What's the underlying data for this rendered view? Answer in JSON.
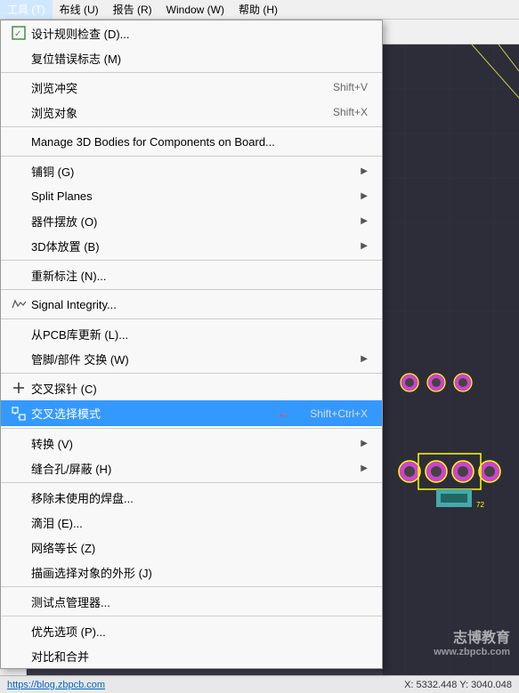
{
  "menubar": {
    "items": [
      {
        "label": "工具 (T)",
        "active": true
      },
      {
        "label": "布线 (U)",
        "active": false
      },
      {
        "label": "报告 (R)",
        "active": false
      },
      {
        "label": "Window (W)",
        "active": false
      },
      {
        "label": "帮助 (H)",
        "active": false
      }
    ]
  },
  "dropdown": {
    "items": [
      {
        "id": "design-rule-check",
        "icon": "✓",
        "text": "设计规则检查 (D)...",
        "shortcut": "",
        "hasArrow": false,
        "separator_after": false,
        "highlighted": false
      },
      {
        "id": "reset-error-marks",
        "icon": "",
        "text": "复位错误标志 (M)",
        "shortcut": "",
        "hasArrow": false,
        "separator_after": true,
        "highlighted": false
      },
      {
        "id": "browse-conflicts",
        "icon": "",
        "text": "浏览冲突",
        "shortcut": "Shift+V",
        "hasArrow": false,
        "separator_after": false,
        "highlighted": false
      },
      {
        "id": "browse-objects",
        "icon": "",
        "text": "浏览对象",
        "shortcut": "Shift+X",
        "hasArrow": false,
        "separator_after": true,
        "highlighted": false
      },
      {
        "id": "manage-3d-bodies",
        "icon": "",
        "text": "Manage 3D Bodies for Components on Board...",
        "shortcut": "",
        "hasArrow": false,
        "separator_after": true,
        "highlighted": false
      },
      {
        "id": "copper-pour",
        "icon": "",
        "text": "铺铜 (G)",
        "shortcut": "",
        "hasArrow": true,
        "separator_after": false,
        "highlighted": false
      },
      {
        "id": "split-planes",
        "icon": "",
        "text": "Split Planes",
        "shortcut": "",
        "hasArrow": true,
        "separator_after": false,
        "highlighted": false
      },
      {
        "id": "component-placement",
        "icon": "",
        "text": "器件摆放 (O)",
        "shortcut": "",
        "hasArrow": true,
        "separator_after": false,
        "highlighted": false
      },
      {
        "id": "3d-placement",
        "icon": "",
        "text": "3D体放置 (B)",
        "shortcut": "",
        "hasArrow": true,
        "separator_after": true,
        "highlighted": false
      },
      {
        "id": "re-annotate",
        "icon": "",
        "text": "重新标注 (N)...",
        "shortcut": "",
        "hasArrow": false,
        "separator_after": true,
        "highlighted": false
      },
      {
        "id": "signal-integrity",
        "icon": "",
        "text": "Signal Integrity...",
        "shortcut": "",
        "hasArrow": false,
        "separator_after": true,
        "highlighted": false
      },
      {
        "id": "update-from-pcb-lib",
        "icon": "",
        "text": "从PCB库更新 (L)...",
        "shortcut": "",
        "hasArrow": false,
        "separator_after": false,
        "highlighted": false
      },
      {
        "id": "pin-swap",
        "icon": "",
        "text": "管脚/部件 交换 (W)",
        "shortcut": "",
        "hasArrow": true,
        "separator_after": true,
        "highlighted": false
      },
      {
        "id": "cross-probe",
        "icon": "",
        "text": "交叉探针 (C)",
        "shortcut": "",
        "hasArrow": false,
        "separator_after": false,
        "highlighted": false
      },
      {
        "id": "cross-select",
        "icon": "➤",
        "text": "交叉选择模式",
        "shortcut": "Shift+Ctrl+X",
        "hasArrow": false,
        "separator_after": true,
        "highlighted": true,
        "hasRedArrow": true
      },
      {
        "id": "convert",
        "icon": "",
        "text": "转换 (V)",
        "shortcut": "",
        "hasArrow": true,
        "separator_after": false,
        "highlighted": false
      },
      {
        "id": "slot-hole-shield",
        "icon": "",
        "text": "缝合孔/屏蔽 (H)",
        "shortcut": "",
        "hasArrow": true,
        "separator_after": true,
        "highlighted": false
      },
      {
        "id": "remove-unused-pads",
        "icon": "",
        "text": "移除未使用的焊盘...",
        "shortcut": "",
        "hasArrow": false,
        "separator_after": false,
        "highlighted": false
      },
      {
        "id": "teardrop",
        "icon": "",
        "text": "滴泪 (E)...",
        "shortcut": "",
        "hasArrow": false,
        "separator_after": false,
        "highlighted": false
      },
      {
        "id": "net-equal-length",
        "icon": "",
        "text": "网络等长 (Z)",
        "shortcut": "",
        "hasArrow": false,
        "separator_after": false,
        "highlighted": false
      },
      {
        "id": "draw-selection-outline",
        "icon": "",
        "text": "描画选择对象的外形 (J)",
        "shortcut": "",
        "hasArrow": false,
        "separator_after": true,
        "highlighted": false
      },
      {
        "id": "testpoint-manager",
        "icon": "",
        "text": "测试点管理器...",
        "shortcut": "",
        "hasArrow": false,
        "separator_after": true,
        "highlighted": false
      },
      {
        "id": "preferences",
        "icon": "",
        "text": "优先选项 (P)...",
        "shortcut": "",
        "hasArrow": false,
        "separator_after": false,
        "highlighted": false
      },
      {
        "id": "compare-merge",
        "icon": "",
        "text": "对比和合并",
        "shortcut": "",
        "hasArrow": false,
        "separator_after": false,
        "highlighted": false
      }
    ]
  },
  "watermark": {
    "line1": "志博教育",
    "line2": "www.zbpcb.com"
  },
  "status": {
    "url": "https://blog.zbpcb.com",
    "coords": "X: 5332.448   Y: 3040.048"
  }
}
